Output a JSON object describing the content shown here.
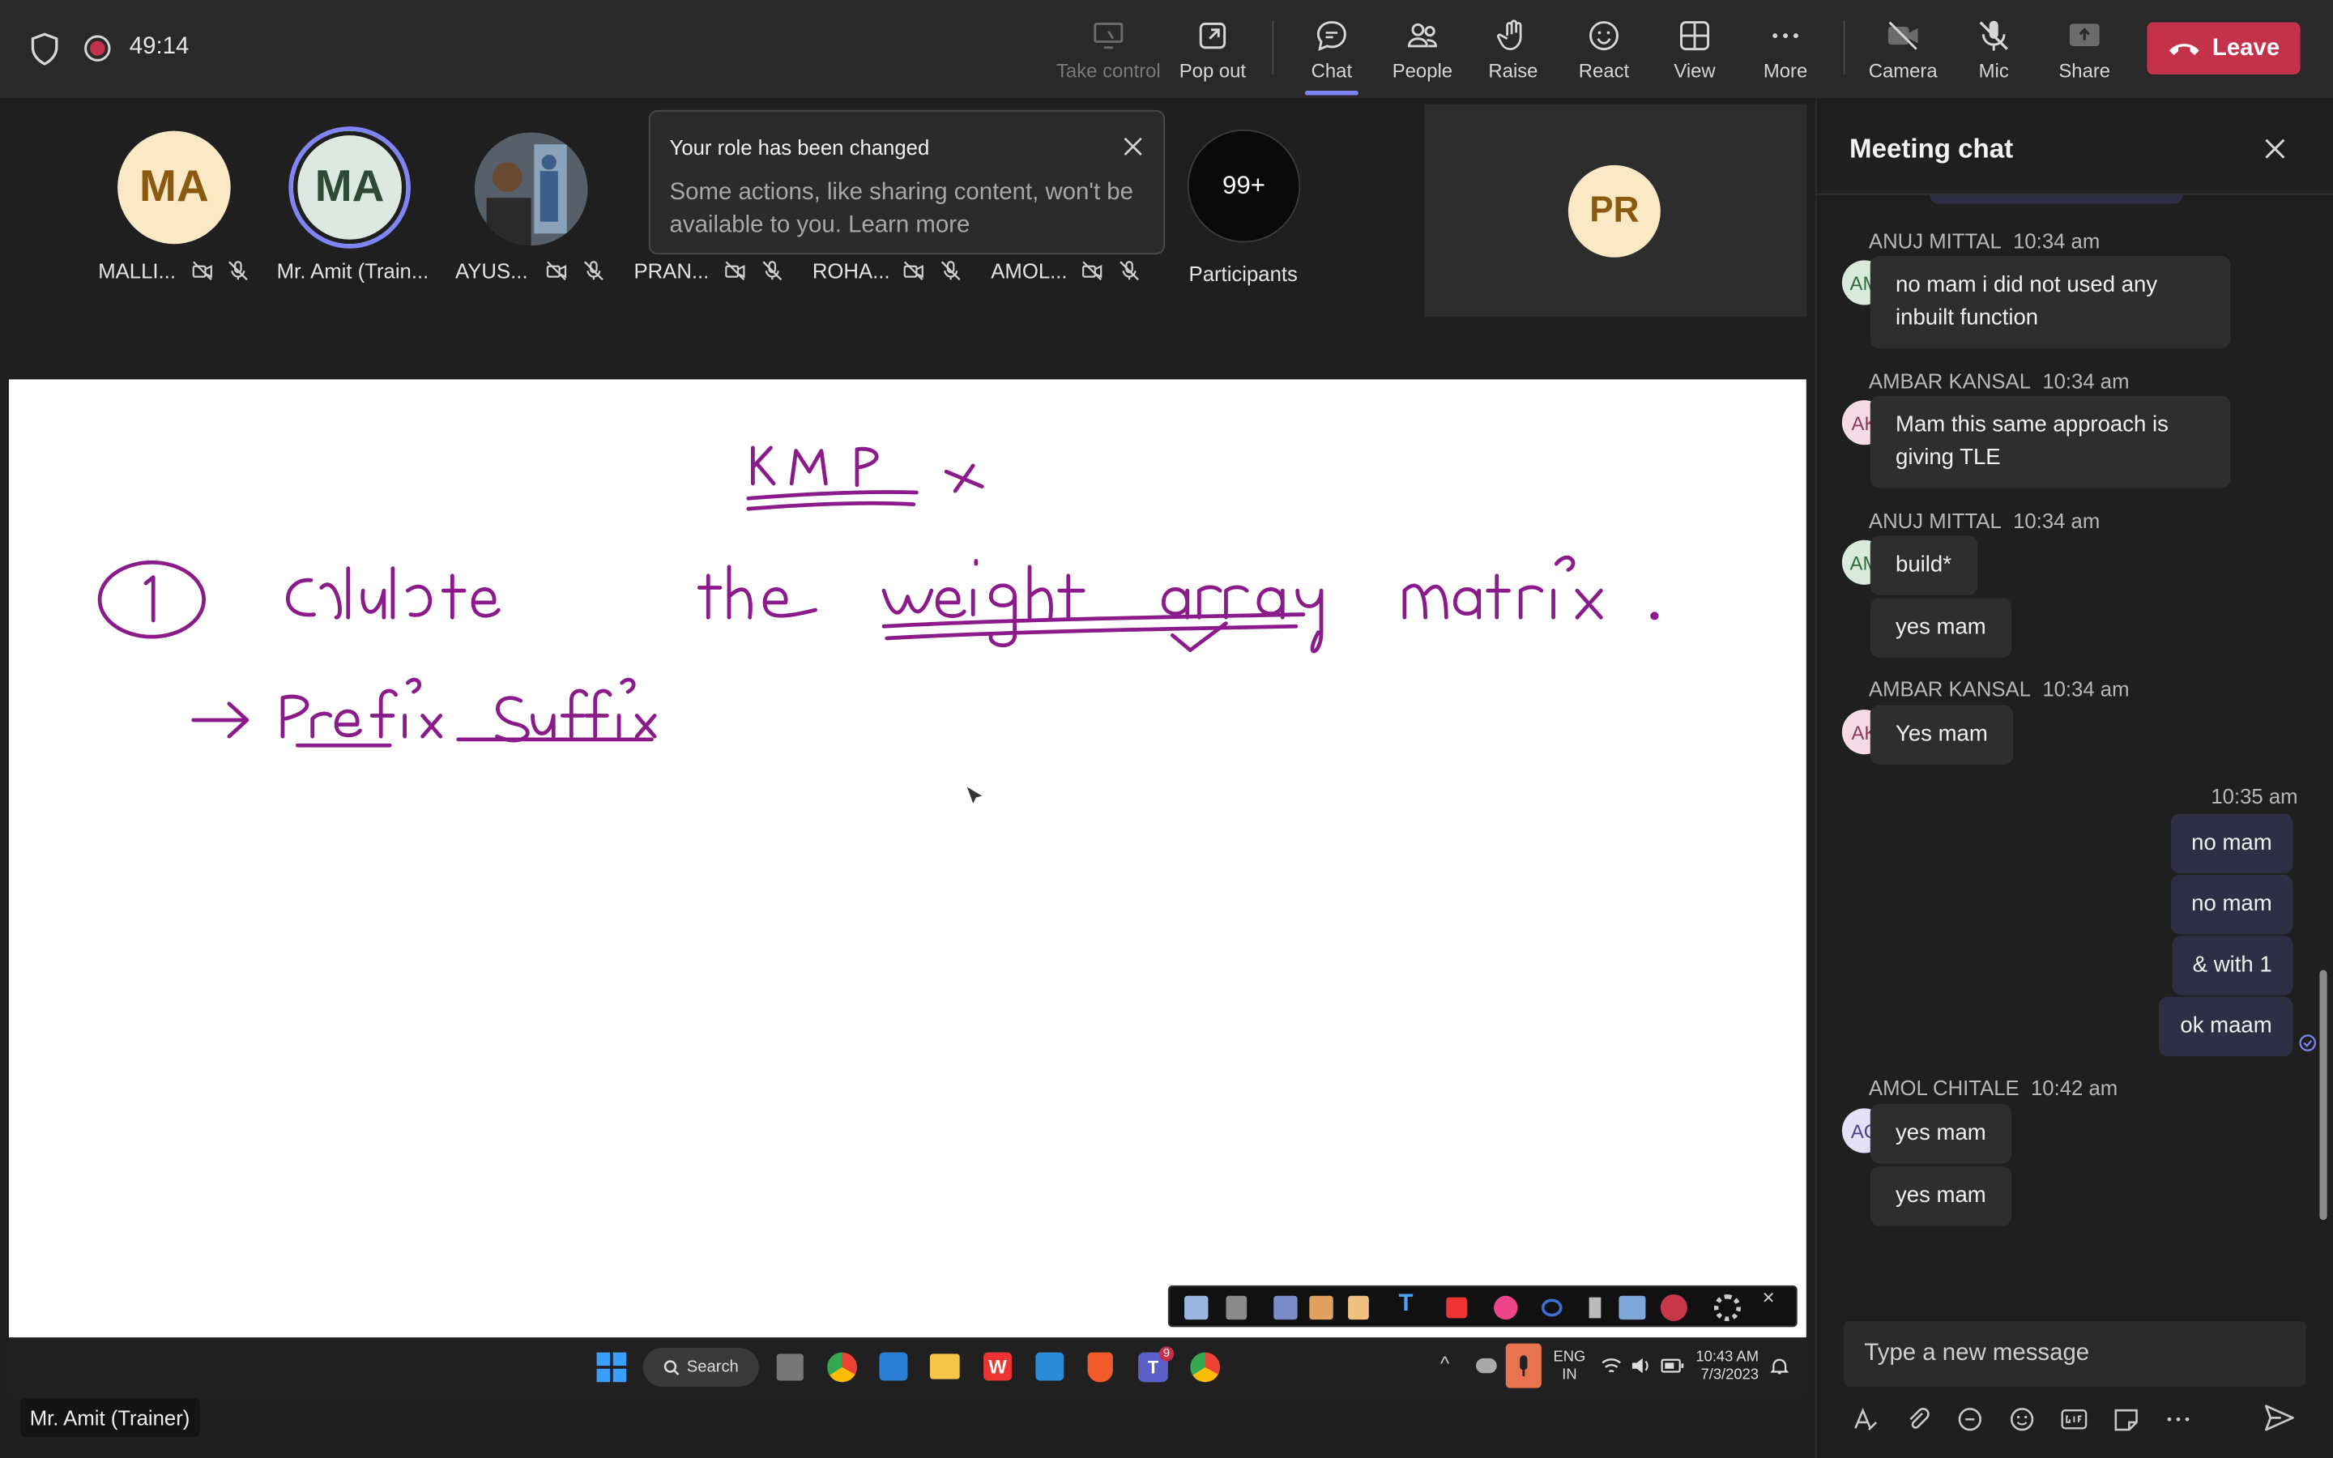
{
  "topbar": {
    "timer": "49:14",
    "take_control": "Take control",
    "pop_out": "Pop out",
    "chat": "Chat",
    "people": "People",
    "raise": "Raise",
    "react": "React",
    "view": "View",
    "more": "More",
    "camera": "Camera",
    "mic": "Mic",
    "share": "Share",
    "leave": "Leave"
  },
  "participants": {
    "p1_initials": "MA",
    "p1_name": "MALLI...",
    "p2_initials": "MA",
    "p2_name": "Mr. Amit (Train...",
    "p3_name": "AYUS...",
    "p4_name": "PRAN...",
    "p5_name": "ROHA...",
    "p6_name": "AMOL...",
    "count": "99+",
    "count_label": "Participants",
    "tile_initials": "PR"
  },
  "toast": {
    "title": "Your role has been changed",
    "body": "Some actions, like sharing content, won't be available to you. Learn more"
  },
  "presenter_label": "Mr. Amit (Trainer)",
  "taskbar": {
    "search": "Search",
    "teams_badge": "9",
    "lang1": "ENG",
    "lang2": "IN",
    "time": "10:43 AM",
    "date": "7/3/2023"
  },
  "chat": {
    "title": "Meeting chat",
    "messages": [
      {
        "author": "ANUJ MITTAL",
        "time": "10:34 am",
        "initials": "AM",
        "text": "no mam i did not used any inbuilt function"
      },
      {
        "author": "AMBAR KANSAL",
        "time": "10:34 am",
        "initials": "AK",
        "text": "Mam this same approach is giving TLE"
      },
      {
        "author": "ANUJ MITTAL",
        "time": "10:34 am",
        "initials": "AM",
        "text": "build*",
        "text2": "yes mam"
      },
      {
        "author": "AMBAR KANSAL",
        "time": "10:34 am",
        "initials": "AK",
        "text": "Yes mam"
      },
      {
        "author": "AMOL CHITALE",
        "time": "10:42 am",
        "initials": "AC",
        "text": "yes mam",
        "text2": "yes mam"
      }
    ],
    "mine": {
      "time": "10:35 am",
      "texts": [
        "no mam",
        "no mam",
        "& with 1",
        "ok maam"
      ]
    },
    "compose_placeholder": "Type a new message"
  },
  "colors": {
    "accent": "#7f85f5",
    "leave": "#c4314b",
    "ink": "#8b1a8b",
    "recording": "#c4314b"
  }
}
